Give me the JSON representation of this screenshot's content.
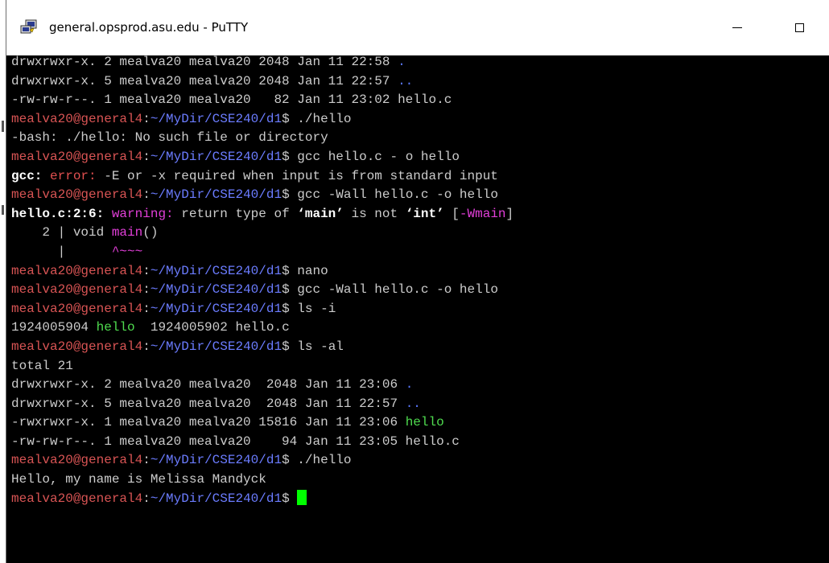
{
  "window": {
    "title": "general.opsprod.asu.edu - PuTTY",
    "icon": "putty-icon",
    "controls": [
      "minimize-icon",
      "maximize-icon"
    ]
  },
  "colors": {
    "background": "#000000",
    "text": "#cccccc",
    "prompt_user": "#d85454",
    "prompt_path": "#6b7cff",
    "error": "#e25050",
    "warning": "#e23fd9",
    "executable": "#4fdc4f",
    "cursor": "#00ff00"
  },
  "terminal": {
    "lines": [
      {
        "type": "listing",
        "text": "drwxrwxr-x. 2 mealva20 mealva20 2048 Jan 11 22:58 ",
        "name": "."
      },
      {
        "type": "listing",
        "text": "drwxrwxr-x. 5 mealva20 mealva20 2048 Jan 11 22:57 ",
        "name": ".."
      },
      {
        "type": "plain",
        "text": "-rw-rw-r--. 1 mealva20 mealva20   82 Jan 11 23:02 hello.c"
      },
      {
        "type": "prompt",
        "user": "mealva20@general4",
        "path": "~/MyDir/CSE240/d1",
        "cmd": "./hello"
      },
      {
        "type": "plain",
        "text": "-bash: ./hello: No such file or directory"
      },
      {
        "type": "prompt",
        "user": "mealva20@general4",
        "path": "~/MyDir/CSE240/d1",
        "cmd": "gcc hello.c - o hello"
      },
      {
        "type": "error",
        "prefix": "gcc: ",
        "label": "error:",
        "text": " -E or -x required when input is from standard input"
      },
      {
        "type": "prompt",
        "user": "mealva20@general4",
        "path": "~/MyDir/CSE240/d1",
        "cmd": "gcc -Wall hello.c -o hello"
      },
      {
        "type": "warning",
        "loc": "hello.c:2:6: ",
        "label": "warning:",
        "t1": " return type of ",
        "q1": "‘main’",
        "t2": " is not ",
        "q2": "‘int’",
        "t3": " [",
        "flag": "-Wmain",
        "t4": "]"
      },
      {
        "type": "source",
        "text": "    2 | void ",
        "fn": "main",
        "rest": "()"
      },
      {
        "type": "caret",
        "text": "      |      ",
        "mark": "^~~~"
      },
      {
        "type": "prompt",
        "user": "mealva20@general4",
        "path": "~/MyDir/CSE240/d1",
        "cmd": "nano"
      },
      {
        "type": "prompt",
        "user": "mealva20@general4",
        "path": "~/MyDir/CSE240/d1",
        "cmd": "gcc -Wall hello.c -o hello"
      },
      {
        "type": "prompt",
        "user": "mealva20@general4",
        "path": "~/MyDir/CSE240/d1",
        "cmd": "ls -i"
      },
      {
        "type": "inode",
        "i1": "1924005904 ",
        "exe": "hello",
        "rest": "  1924005902 hello.c"
      },
      {
        "type": "prompt",
        "user": "mealva20@general4",
        "path": "~/MyDir/CSE240/d1",
        "cmd": "ls -al"
      },
      {
        "type": "plain",
        "text": "total 21"
      },
      {
        "type": "listing",
        "text": "drwxrwxr-x. 2 mealva20 mealva20  2048 Jan 11 23:06 ",
        "name": "."
      },
      {
        "type": "listing",
        "text": "drwxrwxr-x. 5 mealva20 mealva20  2048 Jan 11 22:57 ",
        "name": ".."
      },
      {
        "type": "exec",
        "text": "-rwxrwxr-x. 1 mealva20 mealva20 15816 Jan 11 23:06 ",
        "name": "hello"
      },
      {
        "type": "plain",
        "text": "-rw-rw-r--. 1 mealva20 mealva20    94 Jan 11 23:05 hello.c"
      },
      {
        "type": "prompt",
        "user": "mealva20@general4",
        "path": "~/MyDir/CSE240/d1",
        "cmd": "./hello"
      },
      {
        "type": "plain",
        "text": "Hello, my name is Melissa Mandyck"
      },
      {
        "type": "prompt",
        "user": "mealva20@general4",
        "path": "~/MyDir/CSE240/d1",
        "cmd": "",
        "cursor": true
      }
    ]
  }
}
